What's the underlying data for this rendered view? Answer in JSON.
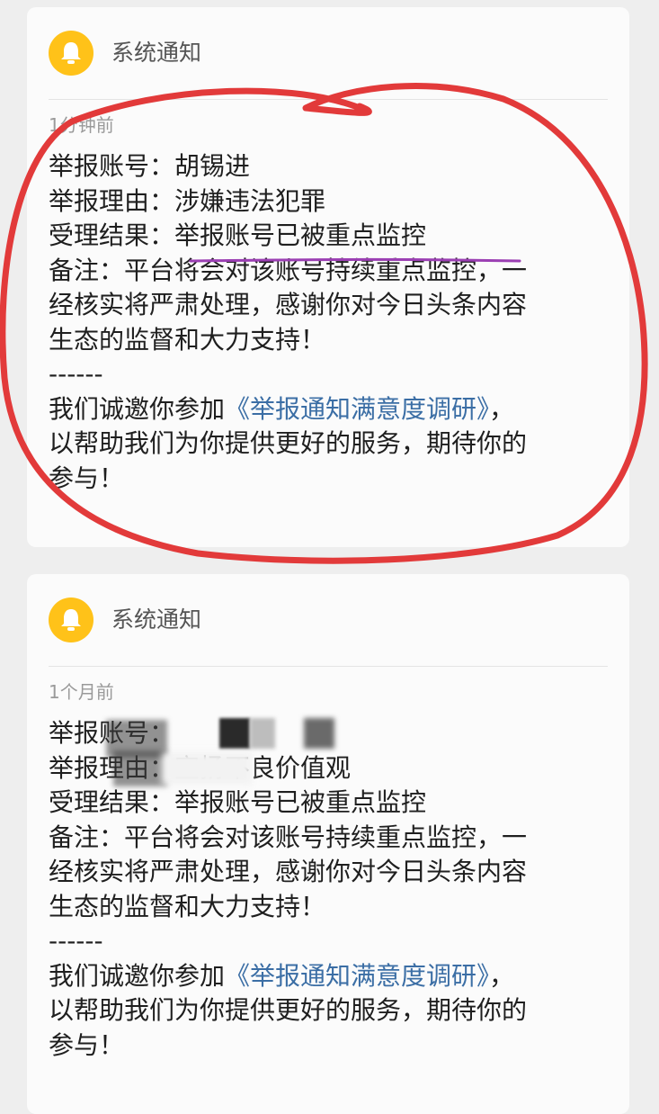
{
  "notifications": [
    {
      "title": "系统通知",
      "time": "1分钟前",
      "reported_account": "举报账号：胡锡进",
      "reason": "举报理由：涉嫌违法犯罪",
      "result": "受理结果：举报账号已被重点监控",
      "note_line1": "备注：平台将会对该账号持续重点监控，一",
      "note_line2": "经核实将严肃处理，感谢你对今日头条内容",
      "note_line3": "生态的监督和大力支持！",
      "separator": "------",
      "invite_prefix": "我们诚邀你参加",
      "invite_link": "《举报通知满意度调研》",
      "invite_suffix": "，",
      "invite_line2": "以帮助我们为你提供更好的服务，期待你的",
      "invite_line3": "参与！"
    },
    {
      "title": "系统通知",
      "time": "1个月前",
      "reported_account": "举报账号：",
      "reason": "举报理由：宣扬不良价值观",
      "result": "受理结果：举报账号已被重点监控",
      "note_line1": "备注：平台将会对该账号持续重点监控，一",
      "note_line2": "经核实将严肃处理，感谢你对今日头条内容",
      "note_line3": "生态的监督和大力支持！",
      "separator": "------",
      "invite_prefix": "我们诚邀你参加",
      "invite_link": "《举报通知满意度调研》",
      "invite_suffix": "，",
      "invite_line2": "以帮助我们为你提供更好的服务，期待你的",
      "invite_line3": "参与！"
    }
  ],
  "colors": {
    "bell": "#ffc219",
    "circle_annotation": "#e23a3a",
    "underline_annotation": "#9b3fb3",
    "link": "#3b6ea5"
  },
  "icons": {
    "notification": "bell-icon"
  }
}
